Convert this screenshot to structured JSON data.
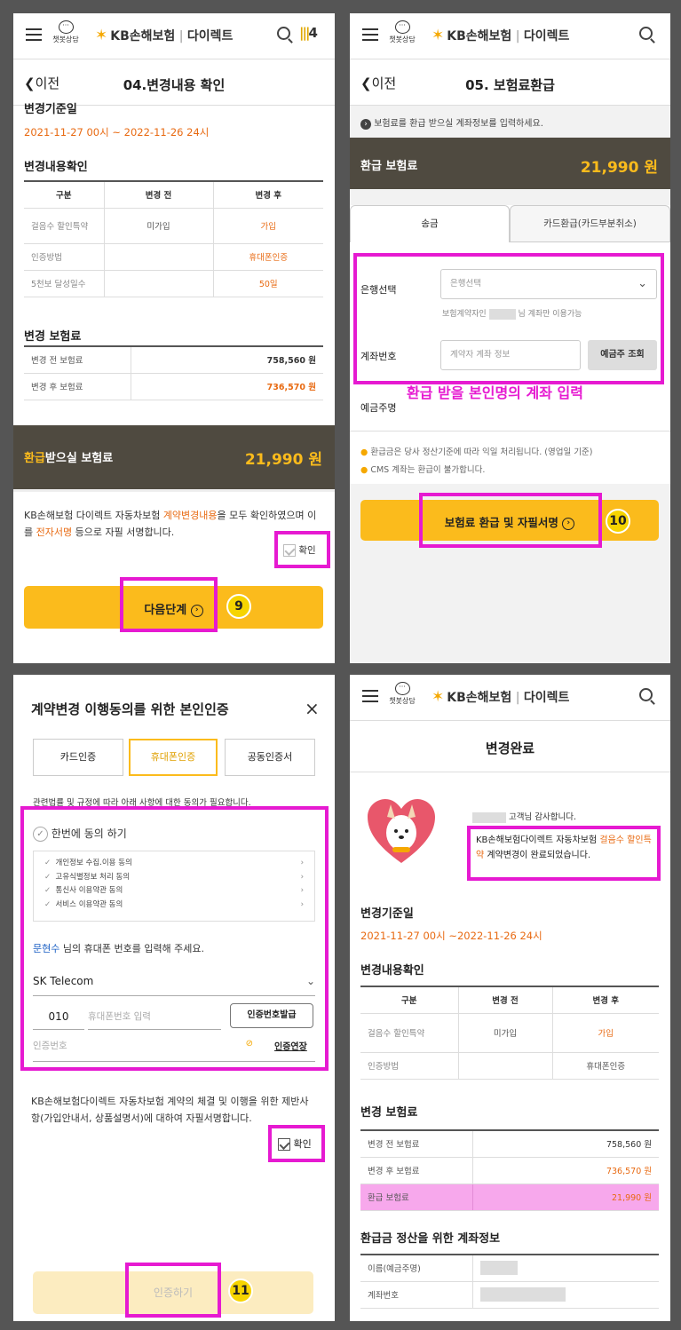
{
  "common": {
    "chat_label": "챗봇상담",
    "brand": "KB손해보험",
    "brand_sub": "다이렉트",
    "back_label": "이전",
    "badge": "4",
    "check_label": "확인",
    "thanks": "고객님 감사합니다.",
    "pink_label": "환급 받을 본인명의 계좌 입력"
  },
  "panel1": {
    "title": "04.변경내용 확인",
    "base_label": "변경기준일",
    "base_date": "2021-11-27 00시 ~ 2022-11-26 24시",
    "content_label": "변경내용확인",
    "table_headers": [
      "구분",
      "변경 전",
      "변경 후"
    ],
    "table_rows": [
      {
        "label": "걸음수 할인특약",
        "before": "미가입",
        "after": "가입"
      },
      {
        "label": "인증방법",
        "before": "",
        "after": "휴대폰인증"
      },
      {
        "label": "5천보 달성일수",
        "before": "",
        "after": "50일"
      }
    ],
    "premium_label": "변경 보험료",
    "premium_rows": [
      {
        "label": "변경 전 보험료",
        "value": "758,560 원"
      },
      {
        "label": "변경 후 보험료",
        "value": "736,570 원"
      }
    ],
    "refund_prefix": "환급",
    "refund_suffix": "받으실 보험료",
    "refund_value": "21,990 원",
    "confirm_parts": [
      "KB손해보험 다이렉트 자동차보험 ",
      "계약변경내용",
      "을 모두 확인하였으며 이를 ",
      "전자서명",
      " 등으로 자필 서명합니다."
    ],
    "next_button": "다음단계",
    "step_num": "9"
  },
  "panel2": {
    "title": "05. 보험료환급",
    "info": "보험료를 환급 받으실 계좌정보를 입력하세요.",
    "refund_label": "환급 보험료",
    "refund_value": "21,990 원",
    "tabs": [
      "송금",
      "카드환급(카드부분취소)"
    ],
    "bank_label": "은행선택",
    "bank_placeholder": "은행선택",
    "holder_note_prefix": "보험계약자인",
    "holder_note_suffix": "님 계좌만 이용가능",
    "account_label": "계좌번호",
    "account_placeholder": "계약자 계좌 정보",
    "lookup_button": "예금주 조회",
    "depositor_label": "예금주명",
    "notes": [
      "환급금은 당사 정산기준에 따라 익일 처리됩니다. (영업일 기준)",
      "CMS 계좌는 환급이 불가합니다."
    ],
    "submit_button": "보험료 환급 및 자필서명",
    "step_num": "10"
  },
  "panel3": {
    "title": "계약변경 이행동의를 위한 본인인증",
    "close": "×",
    "tabs": [
      "카드인증",
      "휴대폰인증",
      "공동인증서"
    ],
    "law_note": "관련법률 및 규정에 따라 아래 사항에 대한 동의가 필요합니다.",
    "agree_all": "한번에 동의 하기",
    "agree_items": [
      "개인정보 수집.이용 동의",
      "고유식별정보 처리 동의",
      "통신사 이용약관 동의",
      "서비스 이용약관 동의"
    ],
    "name": "문현수",
    "phone_prompt": " 님의 휴대폰 번호를 입력해 주세요.",
    "carrier": "SK Telecom",
    "prefix": "010",
    "phone_placeholder": "휴대폰번호 입력",
    "send_button": "인증번호발급",
    "code_placeholder": "인증번호",
    "extend_link": "인증연장",
    "sign_text": "KB손해보험다이렉트 자동차보험 계약의 체결 및 이행을 위한 제반사항(가입안내서, 상품설명서)에 대하여 자필서명합니다.",
    "auth_button": "인증하기",
    "step_num": "11"
  },
  "panel4": {
    "title": "변경완료",
    "msg_prefix": "KB손해보험다이렉트 자동차보험 ",
    "msg_highlight": "걸음수 할인특약",
    "msg_suffix": " 계약변경이 완료되었습니다.",
    "base_label": "변경기준일",
    "base_date": "2021-11-27 00시 ~2022-11-26 24시",
    "content_label": "변경내용확인",
    "table_headers": [
      "구분",
      "변경 전",
      "변경 후"
    ],
    "table_rows": [
      {
        "label": "걸음수 할인특약",
        "before": "미가입",
        "after": "가입"
      },
      {
        "label": "인증방법",
        "before": "",
        "after": "휴대폰인증"
      }
    ],
    "premium_label": "변경 보험료",
    "premium_rows": [
      {
        "label": "변경 전 보험료",
        "value": "758,560 원"
      },
      {
        "label": "변경 후 보험료",
        "value": "736,570 원"
      },
      {
        "label": "환급 보험료",
        "value": "21,990 원"
      }
    ],
    "account_label": "환급금 정산을 위한 계좌정보",
    "account_rows": [
      {
        "label": "이름(예금주명)"
      },
      {
        "label": "계좌번호"
      }
    ]
  },
  "colors": {
    "brand_yellow": "#fbbb1c",
    "highlight_magenta": "#e61ad1",
    "accent_orange": "#e86a12",
    "dark_band": "#4f4a40"
  }
}
